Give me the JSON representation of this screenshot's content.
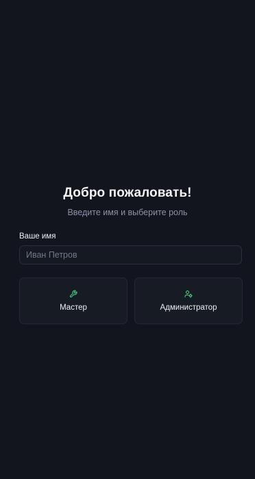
{
  "welcome": {
    "title": "Добро пожаловать!",
    "subtitle": "Введите имя и выберите роль"
  },
  "name_field": {
    "label": "Ваше имя",
    "placeholder": "Иван Петров",
    "value": ""
  },
  "roles": [
    {
      "label": "Мастер",
      "icon": "wrench-icon"
    },
    {
      "label": "Администратор",
      "icon": "user-gear-icon"
    }
  ],
  "colors": {
    "background": "#12151d",
    "card": "#171b24",
    "accent": "#4ade80"
  }
}
